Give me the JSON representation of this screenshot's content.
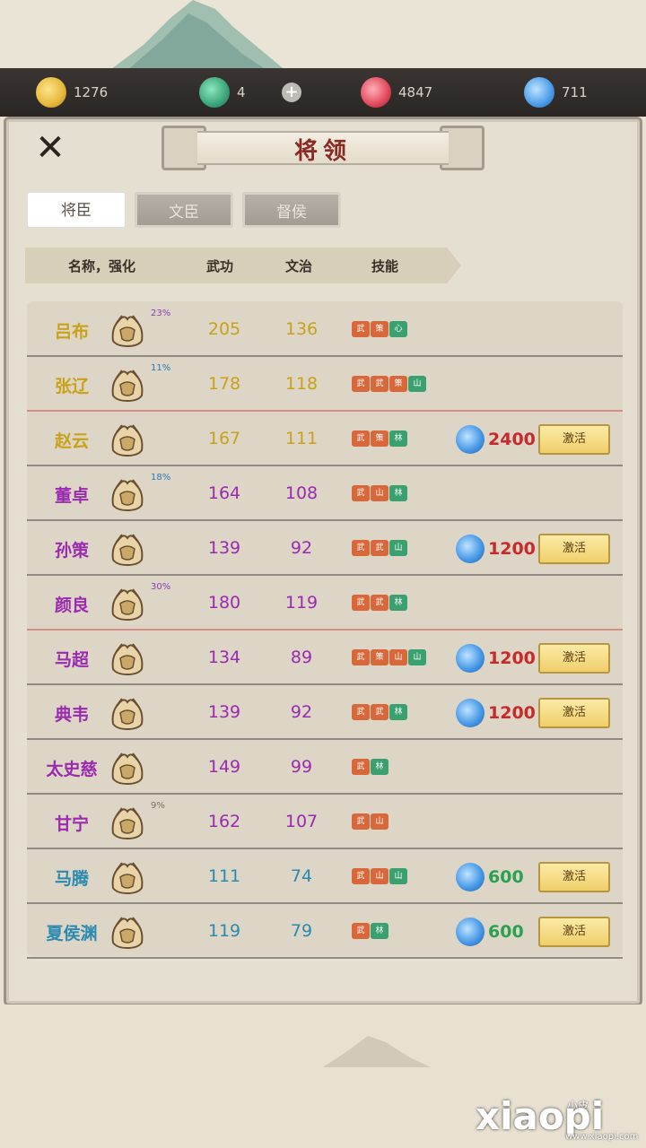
{
  "resources": [
    {
      "icon": "gold-coin-icon",
      "value": "1276",
      "color": "#e6b83a"
    },
    {
      "icon": "jade-token-icon",
      "value": "4",
      "color": "#3aa57a"
    },
    {
      "icon": "red-spirit-icon",
      "value": "4847",
      "color": "#e0485a"
    },
    {
      "icon": "blue-spirit-icon",
      "value": "711",
      "color": "#4a9be8"
    }
  ],
  "add_label": "+",
  "title": "将领",
  "tabs": [
    "将臣",
    "文臣",
    "督侯"
  ],
  "headers": {
    "name": "名称，强化",
    "wu": "武功",
    "wen": "文治",
    "skills": "技能"
  },
  "activate_label": "激活",
  "generals": [
    {
      "name": "吕布",
      "color": "#c9a21a",
      "pct": "23%",
      "pct_color": "#8a3cb0",
      "wu": "205",
      "wen": "136",
      "skills": [
        "武",
        "策",
        "心"
      ],
      "skill_colors": [
        "#d8683a",
        "#d8683a",
        "#3aa070"
      ],
      "cost": "",
      "cost_color": ""
    },
    {
      "name": "张辽",
      "color": "#c9a21a",
      "pct": "11%",
      "pct_color": "#2a78b8",
      "wu": "178",
      "wen": "118",
      "skills": [
        "武",
        "武",
        "策",
        "山"
      ],
      "skill_colors": [
        "#d8683a",
        "#d8683a",
        "#d8683a",
        "#3aa070"
      ],
      "cost": "",
      "cost_color": ""
    },
    {
      "name": "赵云",
      "color": "#c9a21a",
      "pct": "",
      "pct_color": "",
      "wu": "167",
      "wen": "111",
      "skills": [
        "武",
        "策",
        "林"
      ],
      "skill_colors": [
        "#d8683a",
        "#d8683a",
        "#3aa070"
      ],
      "cost": "2400",
      "cost_color": "#c82a2a"
    },
    {
      "name": "董卓",
      "color": "#9a2ab0",
      "pct": "18%",
      "pct_color": "#2a78b8",
      "wu": "164",
      "wen": "108",
      "skills": [
        "武",
        "山",
        "林"
      ],
      "skill_colors": [
        "#d8683a",
        "#d8683a",
        "#3aa070"
      ],
      "cost": "",
      "cost_color": ""
    },
    {
      "name": "孙策",
      "color": "#9a2ab0",
      "pct": "",
      "pct_color": "",
      "wu": "139",
      "wen": "92",
      "skills": [
        "武",
        "武",
        "山"
      ],
      "skill_colors": [
        "#d8683a",
        "#d8683a",
        "#3aa070"
      ],
      "cost": "1200",
      "cost_color": "#c82a2a"
    },
    {
      "name": "颜良",
      "color": "#9a2ab0",
      "pct": "30%",
      "pct_color": "#8a3cb0",
      "wu": "180",
      "wen": "119",
      "skills": [
        "武",
        "武",
        "林"
      ],
      "skill_colors": [
        "#d8683a",
        "#d8683a",
        "#3aa070"
      ],
      "cost": "",
      "cost_color": ""
    },
    {
      "name": "马超",
      "color": "#9a2ab0",
      "pct": "",
      "pct_color": "",
      "wu": "134",
      "wen": "89",
      "skills": [
        "武",
        "策",
        "山",
        "山"
      ],
      "skill_colors": [
        "#d8683a",
        "#d8683a",
        "#d8683a",
        "#3aa070"
      ],
      "cost": "1200",
      "cost_color": "#c82a2a"
    },
    {
      "name": "典韦",
      "color": "#9a2ab0",
      "pct": "",
      "pct_color": "",
      "wu": "139",
      "wen": "92",
      "skills": [
        "武",
        "武",
        "林"
      ],
      "skill_colors": [
        "#d8683a",
        "#d8683a",
        "#3aa070"
      ],
      "cost": "1200",
      "cost_color": "#c82a2a"
    },
    {
      "name": "太史慈",
      "color": "#9a2ab0",
      "pct": "",
      "pct_color": "",
      "wu": "149",
      "wen": "99",
      "skills": [
        "武",
        "林"
      ],
      "skill_colors": [
        "#d8683a",
        "#3aa070"
      ],
      "cost": "",
      "cost_color": ""
    },
    {
      "name": "甘宁",
      "color": "#9a2ab0",
      "pct": "9%",
      "pct_color": "#7a7068",
      "wu": "162",
      "wen": "107",
      "skills": [
        "武",
        "山"
      ],
      "skill_colors": [
        "#d8683a",
        "#d8683a"
      ],
      "cost": "",
      "cost_color": ""
    },
    {
      "name": "马腾",
      "color": "#2a8ab0",
      "pct": "",
      "pct_color": "",
      "wu": "111",
      "wen": "74",
      "skills": [
        "武",
        "山",
        "山"
      ],
      "skill_colors": [
        "#d8683a",
        "#d8683a",
        "#3aa070"
      ],
      "cost": "600",
      "cost_color": "#2aa050"
    },
    {
      "name": "夏侯渊",
      "color": "#2a8ab0",
      "pct": "",
      "pct_color": "",
      "wu": "119",
      "wen": "79",
      "skills": [
        "武",
        "林"
      ],
      "skill_colors": [
        "#d8683a",
        "#3aa070"
      ],
      "cost": "600",
      "cost_color": "#2aa050"
    }
  ],
  "watermark": {
    "main": "xiaopi",
    "small": "小皮",
    "url": "www.xiaopi.com"
  }
}
